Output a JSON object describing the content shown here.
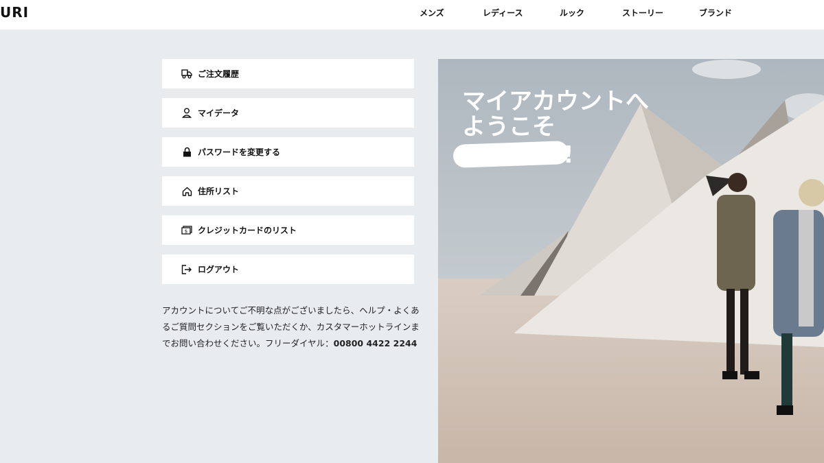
{
  "header": {
    "logo": "URI",
    "nav": [
      {
        "label": "メンズ"
      },
      {
        "label": "レディース"
      },
      {
        "label": "ルック"
      },
      {
        "label": "ストーリー"
      },
      {
        "label": "ブランド"
      }
    ]
  },
  "account_menu": [
    {
      "label": "ご注文履歴",
      "icon": "truck-icon"
    },
    {
      "label": "マイデータ",
      "icon": "user-icon"
    },
    {
      "label": "パスワードを変更する",
      "icon": "lock-icon"
    },
    {
      "label": "住所リスト",
      "icon": "home-icon"
    },
    {
      "label": "クレジットカードのリスト",
      "icon": "credit-card-icon"
    },
    {
      "label": "ログアウト",
      "icon": "logout-icon"
    }
  ],
  "help": {
    "text": "アカウントについてご不明な点がございましたら、ヘルプ・よくあるご質問セクションをご覧いただくか、カスタマーホットラインまでお問い合わせください。フリーダイヤル：",
    "phone": "00800 4422 2244"
  },
  "hero": {
    "welcome_line1": "マイアカウントへ",
    "welcome_line2": "ようこそ",
    "exclamation": "!"
  }
}
